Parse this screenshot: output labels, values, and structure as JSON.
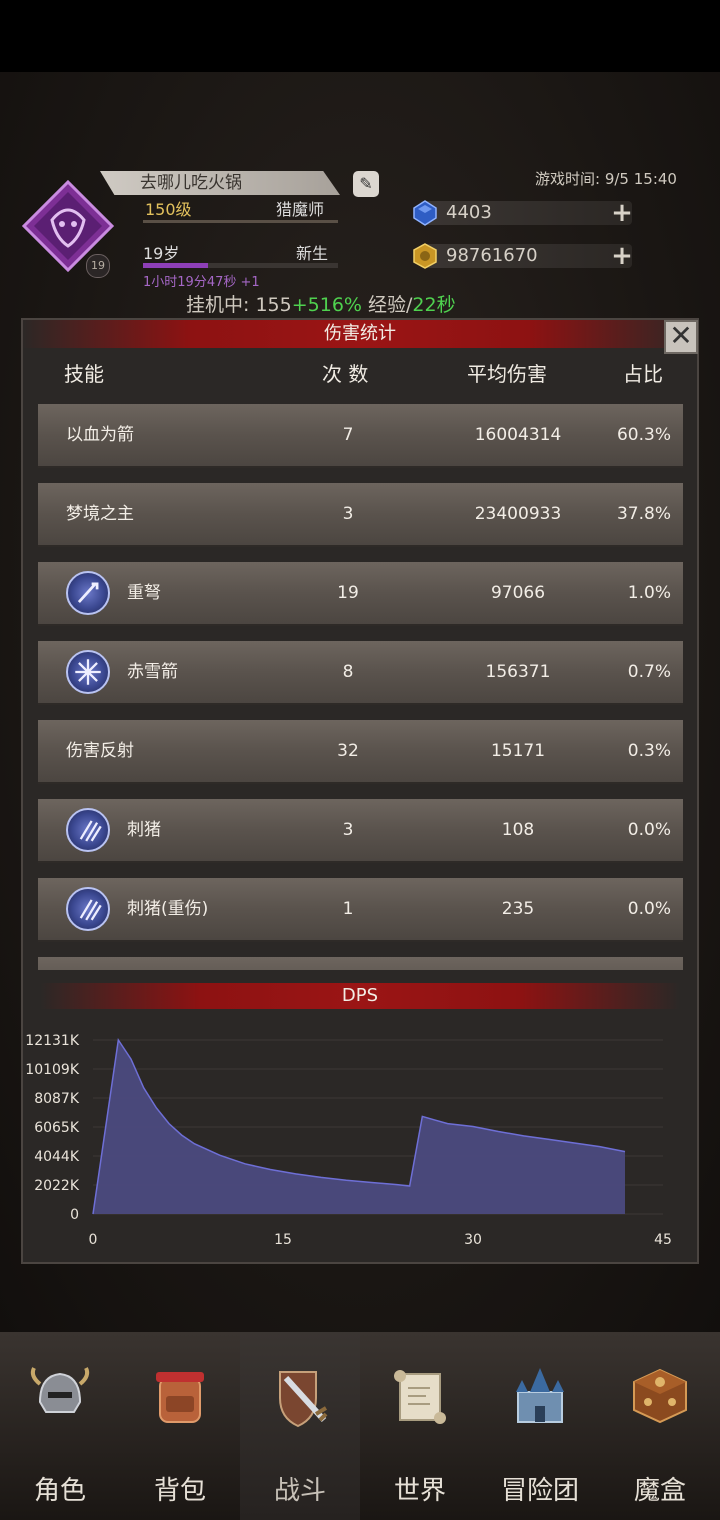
{
  "header": {
    "player_name": "去哪儿吃火锅",
    "level": "150级",
    "job": "猎魔师",
    "age": "19岁",
    "status": "新生",
    "timer": "1小时19分47秒  +1",
    "avatar_level": "19",
    "game_time": "游戏时间: 9/5 15:40",
    "gems": "4403",
    "coins": "98761670",
    "idle_prefix": "挂机中: 155",
    "idle_bonus": "+516%",
    "idle_exp": " 经验/",
    "idle_time": "22秒"
  },
  "panel": {
    "title": "伤害统计",
    "close_label": "✕",
    "columns": [
      "技能",
      "次 数",
      "平均伤害",
      "占比"
    ],
    "rows": [
      {
        "skill": "以血为箭",
        "count": "7",
        "avg": "16004314",
        "ratio": "60.3%",
        "icon": ""
      },
      {
        "skill": "梦境之主",
        "count": "3",
        "avg": "23400933",
        "ratio": "37.8%",
        "icon": ""
      },
      {
        "skill": "重弩",
        "count": "19",
        "avg": "97066",
        "ratio": "1.0%",
        "icon": "crossbow-icon"
      },
      {
        "skill": "赤雪箭",
        "count": "8",
        "avg": "156371",
        "ratio": "0.7%",
        "icon": "snow-arrow-icon"
      },
      {
        "skill": "伤害反射",
        "count": "32",
        "avg": "15171",
        "ratio": "0.3%",
        "icon": ""
      },
      {
        "skill": "刺猪",
        "count": "3",
        "avg": "108",
        "ratio": "0.0%",
        "icon": "claw-icon"
      },
      {
        "skill": "刺猪(重伤)",
        "count": "1",
        "avg": "235",
        "ratio": "0.0%",
        "icon": "claw-icon"
      }
    ]
  },
  "chart_data": {
    "type": "area",
    "title": "DPS",
    "x": [
      0,
      2,
      3,
      4,
      5,
      6,
      7,
      8,
      10,
      12,
      14,
      16,
      18,
      20,
      22,
      24,
      25,
      26,
      27,
      28,
      30,
      32,
      34,
      36,
      38,
      40,
      42
    ],
    "y": [
      0,
      12131,
      10800,
      8800,
      7400,
      6300,
      5500,
      4900,
      4100,
      3500,
      3100,
      2800,
      2550,
      2350,
      2200,
      2050,
      1950,
      6800,
      6550,
      6300,
      6100,
      5750,
      5450,
      5200,
      4950,
      4700,
      4350
    ],
    "x_ticks": [
      "0",
      "15",
      "30",
      "45"
    ],
    "y_ticks": [
      "0",
      "2022K",
      "4044K",
      "6065K",
      "8087K",
      "10109K",
      "12131K"
    ],
    "xlim": [
      0,
      45
    ],
    "ylim": [
      0,
      12131
    ],
    "colors": {
      "fill": "#4b4a7e",
      "line": "#6e6fd6"
    }
  },
  "nav": [
    {
      "label": "角色",
      "icon": "helmet-icon"
    },
    {
      "label": "背包",
      "icon": "backpack-icon"
    },
    {
      "label": "战斗",
      "icon": "sword-shield-icon"
    },
    {
      "label": "世界",
      "icon": "scroll-map-icon"
    },
    {
      "label": "冒险团",
      "icon": "castle-icon"
    },
    {
      "label": "魔盒",
      "icon": "magic-box-icon"
    }
  ]
}
